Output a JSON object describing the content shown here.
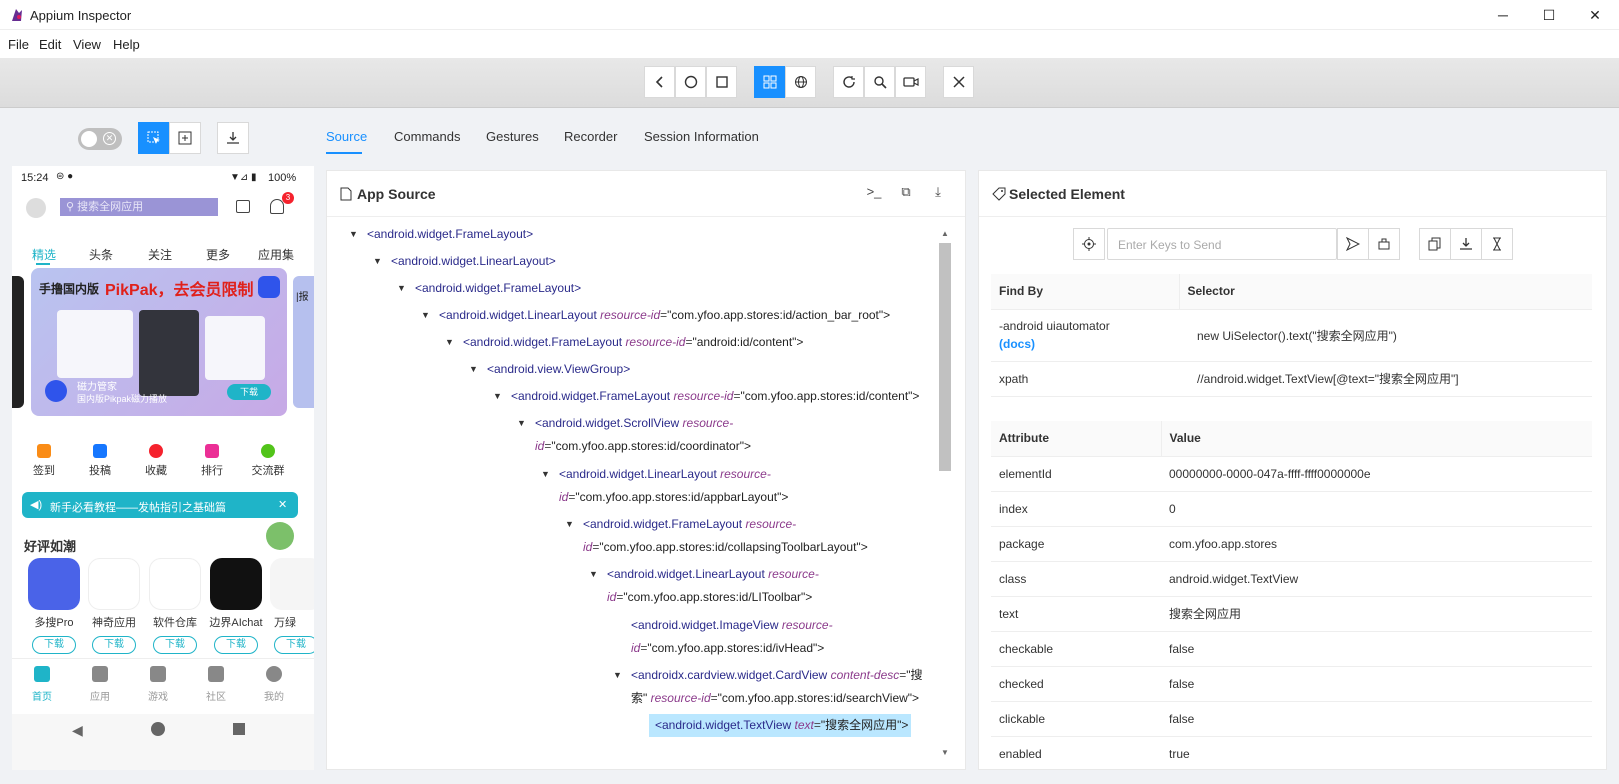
{
  "window": {
    "title": "Appium Inspector"
  },
  "menu": [
    "File",
    "Edit",
    "View",
    "Help"
  ],
  "tabs": [
    "Source",
    "Commands",
    "Gestures",
    "Recorder",
    "Session Information"
  ],
  "phone": {
    "time": "15:24",
    "battery": "100%",
    "search_placeholder": "搜索全网应用",
    "badge": "3",
    "nav_tabs": [
      "精选",
      "头条",
      "关注",
      "更多",
      "应用集"
    ],
    "banner_title_a": "手撸国内版",
    "banner_title_b": "PikPak，去会员限制",
    "banner_line1": "磁力管家",
    "banner_line2": "国内版Pikpak磁力播放",
    "banner_dl": "下载",
    "side_banner": "|报",
    "quick": [
      "签到",
      "投稿",
      "收藏",
      "排行",
      "交流群"
    ],
    "notice": "新手必看教程——发帖指引之基础篇",
    "section": "好评如潮",
    "apps": [
      "多搜Pro",
      "神奇应用",
      "软件仓库",
      "边界AIchat",
      "万绿"
    ],
    "app_dl": "下载",
    "bottom_nav": [
      "首页",
      "应用",
      "游戏",
      "社区",
      "我的"
    ]
  },
  "source_panel": {
    "title": "App Source",
    "nodes": [
      {
        "tag": "<android.widget.FrameLayout>"
      },
      {
        "tag": "<android.widget.LinearLayout>"
      },
      {
        "tag": "<android.widget.FrameLayout>"
      },
      {
        "tag": "<android.widget.LinearLayout",
        "attr": "resource-id",
        "val": "\"com.yfoo.app.stores:id/action_bar_root\">"
      },
      {
        "tag": "<android.widget.FrameLayout",
        "attr": "resource-id",
        "val": "\"android:id/content\">"
      },
      {
        "tag": "<android.view.ViewGroup>"
      },
      {
        "tag": "<android.widget.FrameLayout",
        "attr": "resource-id",
        "val": "\"com.yfoo.app.stores:id/content\">"
      },
      {
        "tag": "<android.widget.ScrollView",
        "attr": "resource-",
        "val": ""
      },
      {
        "tag": "",
        "attr": "id",
        "val": "\"com.yfoo.app.stores:id/coordinator\">"
      },
      {
        "tag": "<android.widget.LinearLayout",
        "attr": "resource-",
        "val": ""
      },
      {
        "tag": "",
        "attr": "id",
        "val": "\"com.yfoo.app.stores:id/appbarLayout\">"
      },
      {
        "tag": "<android.widget.FrameLayout",
        "attr": "resource-",
        "val": ""
      },
      {
        "tag": "",
        "attr": "id",
        "val": "\"com.yfoo.app.stores:id/collapsingToolbarLayout\">"
      },
      {
        "tag": "<android.widget.LinearLayout",
        "attr": "resource-",
        "val": ""
      },
      {
        "tag": "",
        "attr": "id",
        "val": "\"com.yfoo.app.stores:id/LIToolbar\">"
      },
      {
        "tag": "<android.widget.ImageView",
        "attr": "resource-",
        "val": ""
      },
      {
        "tag": "",
        "attr": "id",
        "val": "\"com.yfoo.app.stores:id/ivHead\">"
      },
      {
        "tag": "<androidx.cardview.widget.CardView",
        "attr": "content-desc",
        "val": "\"搜"
      },
      {
        "tag": "",
        "val": "索\"",
        "attr2": "resource-id",
        "val2": "\"com.yfoo.app.stores:id/searchView\">"
      },
      {
        "tag": "<android.widget.TextView",
        "attr": "text",
        "val": "\"搜索全网应用\">"
      }
    ]
  },
  "selected_panel": {
    "title": "Selected Element",
    "keys_placeholder": "Enter Keys to Send",
    "find_headers": [
      "Find By",
      "Selector"
    ],
    "find_rows": [
      {
        "by": "-android uiautomator",
        "docs": "(docs)",
        "selector": "new UiSelector().text(\"搜索全网应用\")"
      },
      {
        "by": "xpath",
        "docs": "",
        "selector": "//android.widget.TextView[@text=\"搜索全网应用\"]"
      }
    ],
    "attr_headers": [
      "Attribute",
      "Value"
    ],
    "attrs": [
      {
        "k": "elementId",
        "v": "00000000-0000-047a-ffff-ffff0000000e"
      },
      {
        "k": "index",
        "v": "0"
      },
      {
        "k": "package",
        "v": "com.yfoo.app.stores"
      },
      {
        "k": "class",
        "v": "android.widget.TextView"
      },
      {
        "k": "text",
        "v": "搜索全网应用"
      },
      {
        "k": "checkable",
        "v": "false"
      },
      {
        "k": "checked",
        "v": "false"
      },
      {
        "k": "clickable",
        "v": "false"
      },
      {
        "k": "enabled",
        "v": "true"
      }
    ]
  },
  "colors": {
    "accent": "#1890ff",
    "teal": "#1fb4c8",
    "highlight": "#bae7ff"
  }
}
